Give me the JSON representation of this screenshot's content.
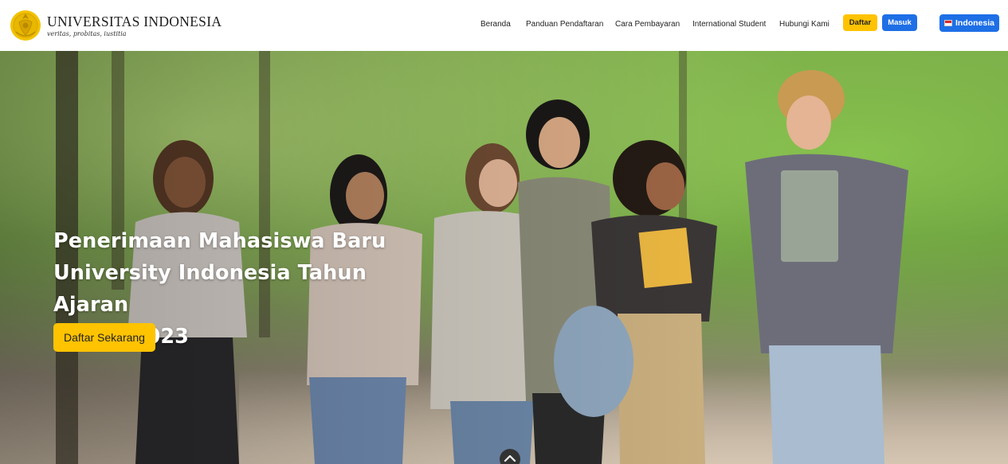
{
  "brand": {
    "name": "UNIVERSITAS INDONESIA",
    "motto": "veritas, probitas, iustitia",
    "logo_icon": "ui-makara-logo-icon",
    "logo_color": "#E8B800"
  },
  "nav": {
    "items": [
      {
        "label": "Beranda"
      },
      {
        "label": "Panduan Pendaftaran"
      },
      {
        "label": "Cara Pembayaran"
      },
      {
        "label": "International Student"
      },
      {
        "label": "Hubungi Kami"
      }
    ],
    "daftar_label": "Daftar",
    "masuk_label": "Masuk",
    "language_label": "Indonesia",
    "language_icon": "indonesia-flag-icon"
  },
  "hero": {
    "title_line1": "Penerimaan Mahasiswa Baru",
    "title_line2": "University Indonesia Tahun Ajaran",
    "title_line3": "20222/2023",
    "cta_label": "Daftar Sekarang",
    "background": "photo-students-walking-in-park",
    "scroll_icon": "chevron-up-icon"
  },
  "colors": {
    "accent_yellow": "#FFC300",
    "accent_blue": "#1E6FE6"
  }
}
